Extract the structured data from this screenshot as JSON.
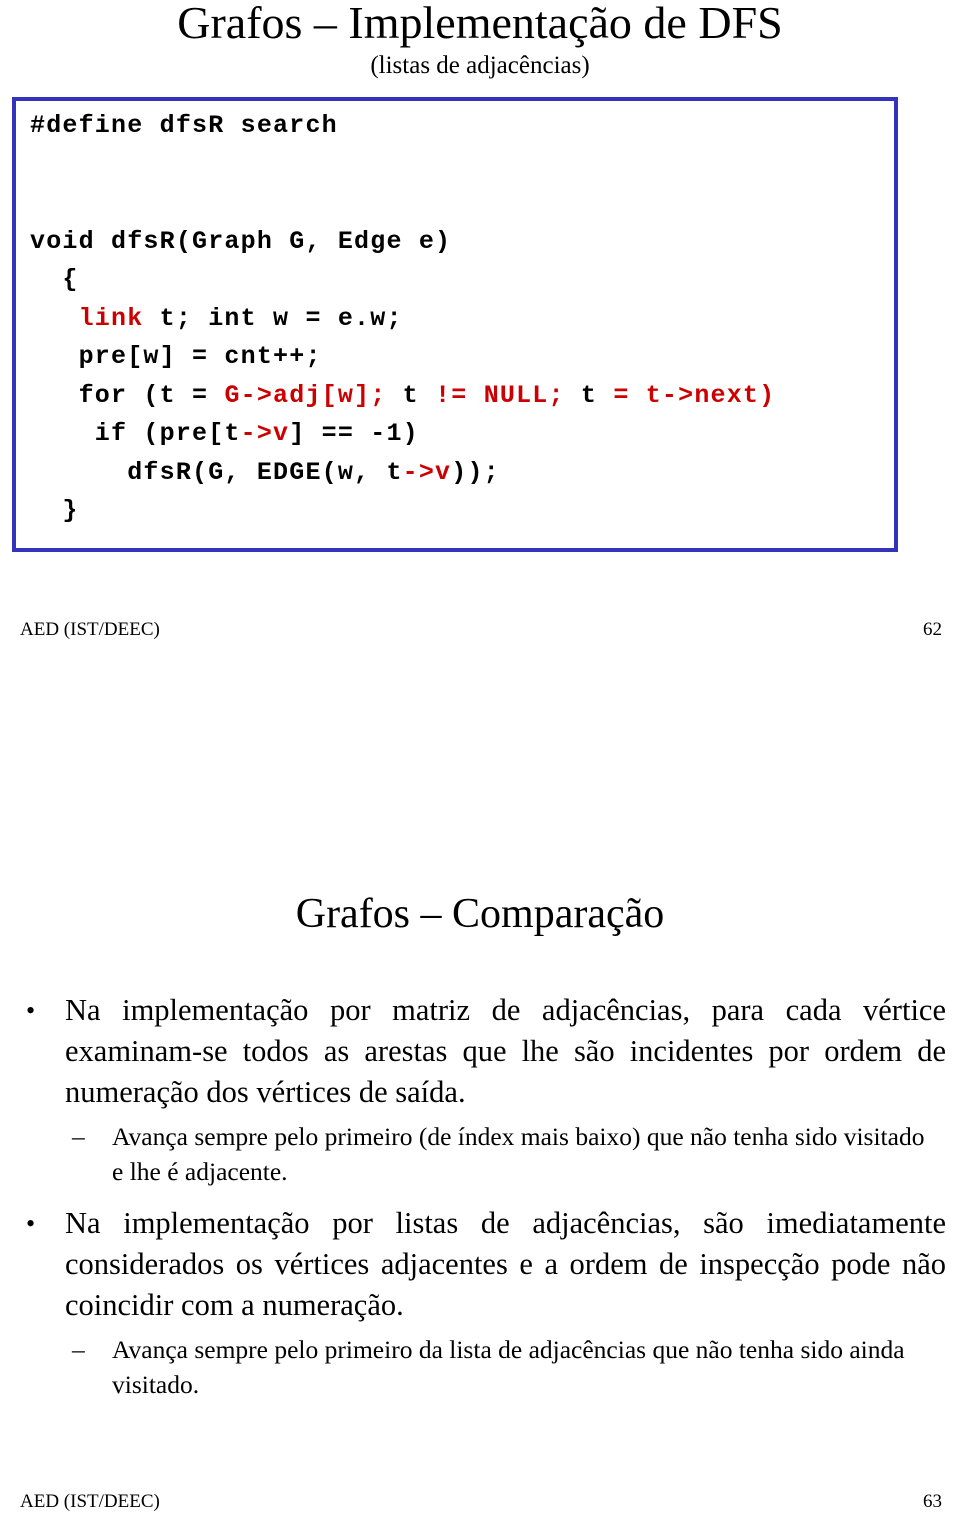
{
  "slide1": {
    "title": "Grafos – Implementação de DFS",
    "subtitle": "(listas de adjacências)",
    "code": {
      "line1": "#define dfsR search",
      "line2": "void dfsR(Graph G, Edge e)",
      "line3": "  {",
      "line4_pre": "   ",
      "line4_kw": "link",
      "line4_post": " t; int w = e.w;",
      "line5": "   pre[w] = cnt++;",
      "line6_a": "   for (t = ",
      "line6_b": "G->adj[w];",
      "line6_c": " t ",
      "line6_d": "!=",
      "line6_e": " ",
      "line6_f": "NULL;",
      "line6_g": " t ",
      "line6_h": "= t->next)",
      "line7_a": "    if (pre[t",
      "line7_b": "->v",
      "line7_c": "] == -1)",
      "line8_a": "      dfsR(G, EDGE(w, t",
      "line8_b": "->v",
      "line8_c": "));",
      "line9": "  }"
    },
    "footer_left": "AED (IST/DEEC)",
    "footer_page": "62"
  },
  "slide2": {
    "title": "Grafos – Comparação",
    "bullets": [
      {
        "level": 1,
        "marker": "•",
        "text": "Na implementação por matriz de adjacências, para cada vértice examinam-se todos as arestas que lhe são incidentes por ordem de numeração dos vértices de saída."
      },
      {
        "level": 2,
        "marker": "–",
        "text": "Avança sempre pelo primeiro (de índex mais baixo) que não tenha sido visitado e lhe é adjacente."
      },
      {
        "level": 1,
        "marker": "•",
        "text": "Na implementação por listas de adjacências, são imediatamente considerados os vértices adjacentes e a ordem de inspecção pode não coincidir com a numeração."
      },
      {
        "level": 2,
        "marker": "–",
        "text": "Avança sempre pelo primeiro da lista de adjacências que não tenha sido ainda visitado."
      }
    ],
    "footer_left": "AED (IST/DEEC)",
    "footer_page": "63"
  },
  "colors": {
    "code_border": "#3333bb",
    "code_highlight": "#cc0000",
    "text": "#000000"
  }
}
